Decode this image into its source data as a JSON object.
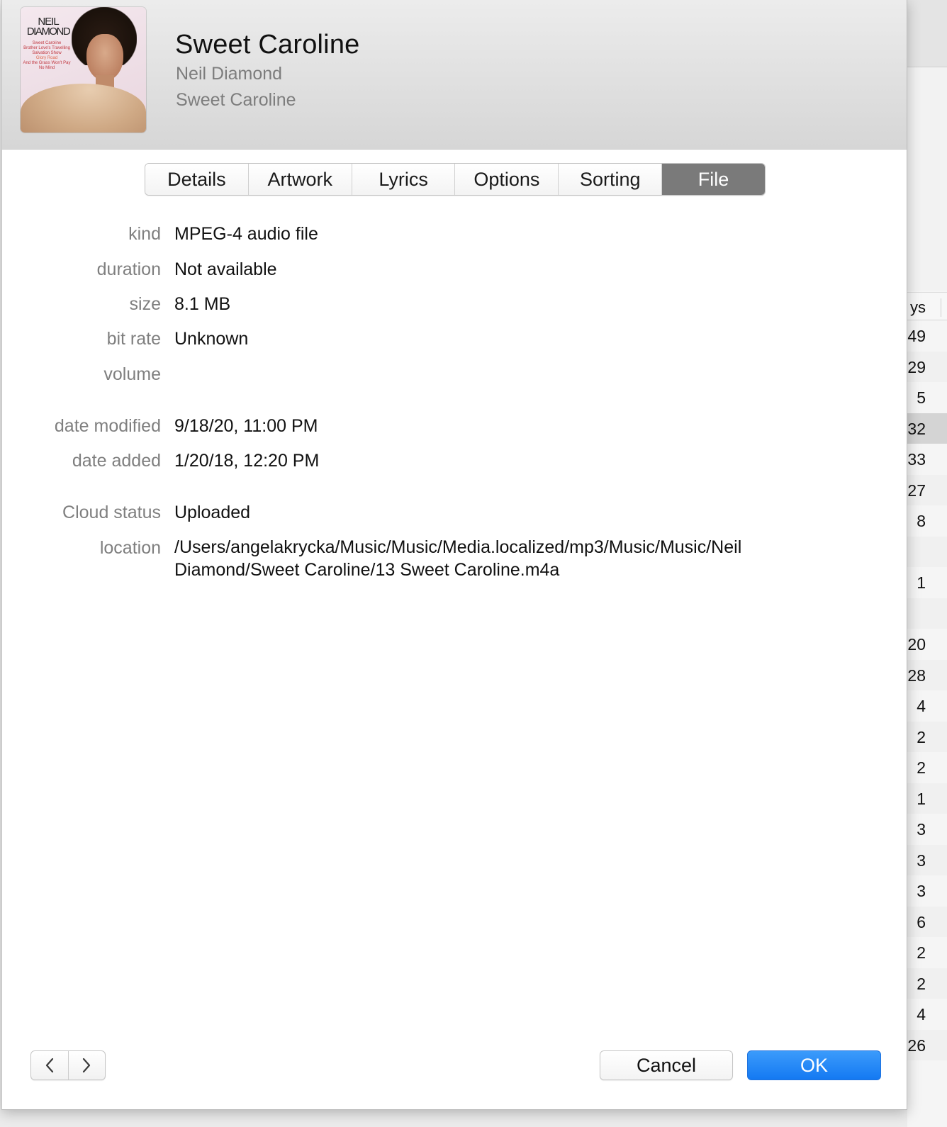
{
  "track": {
    "title": "Sweet Caroline",
    "artist": "Neil Diamond",
    "album": "Sweet Caroline"
  },
  "artwork": {
    "title_line1": "NEIL",
    "title_line2": "DIAMOND",
    "track_list": [
      "Sweet Caroline",
      "Brother Love's Travelling",
      "Salvation Show",
      "Glory Road",
      "And the Grass Won't Pay",
      "No Mind"
    ]
  },
  "tabs": [
    {
      "label": "Details",
      "active": false
    },
    {
      "label": "Artwork",
      "active": false
    },
    {
      "label": "Lyrics",
      "active": false
    },
    {
      "label": "Options",
      "active": false
    },
    {
      "label": "Sorting",
      "active": false
    },
    {
      "label": "File",
      "active": true
    }
  ],
  "fields": {
    "kind": {
      "label": "kind",
      "value": "MPEG-4 audio file"
    },
    "duration": {
      "label": "duration",
      "value": "Not available"
    },
    "size": {
      "label": "size",
      "value": "8.1 MB"
    },
    "bit_rate": {
      "label": "bit rate",
      "value": "Unknown"
    },
    "volume": {
      "label": "volume",
      "value": ""
    },
    "date_modified": {
      "label": "date modified",
      "value": "9/18/20, 11:00 PM"
    },
    "date_added": {
      "label": "date added",
      "value": "1/20/18, 12:20 PM"
    },
    "cloud_status": {
      "label": "Cloud status",
      "value": "Uploaded"
    },
    "location": {
      "label": "location",
      "value": "/Users/angelakrycka/Music/Music/Media.localized/mp3/Music/Music/Neil Diamond/Sweet Caroline/13 Sweet Caroline.m4a"
    }
  },
  "buttons": {
    "cancel": "Cancel",
    "ok": "OK"
  },
  "background_list": {
    "header": "ys",
    "rows": [
      "49",
      "29",
      "5",
      "32",
      "33",
      "27",
      "8",
      "",
      "1",
      "",
      "20",
      "28",
      "4",
      "2",
      "2",
      "1",
      "3",
      "3",
      "3",
      "6",
      "2",
      "2",
      "4",
      "26"
    ]
  },
  "colors": {
    "accent": "#1479f2",
    "active_tab": "#7a7a7a",
    "label_gray": "#7f7f7f"
  }
}
